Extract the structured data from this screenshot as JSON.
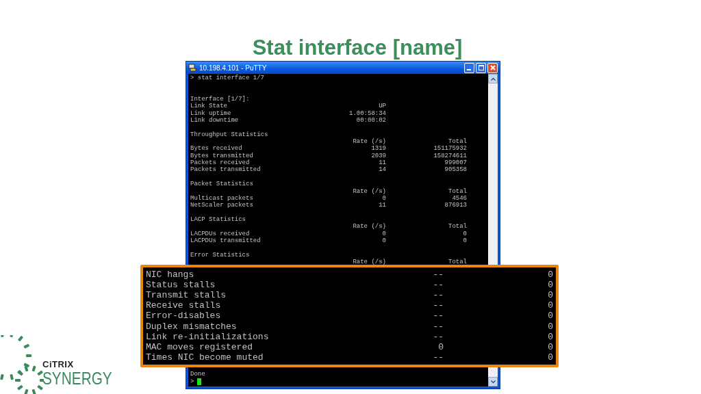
{
  "slide_title": "Stat interface [name]",
  "window": {
    "title": "10.198.4.101 - PuTTY"
  },
  "terminal": {
    "lines": [
      {
        "kind": "command",
        "text": "> stat interface 1/7"
      },
      {
        "kind": "blank"
      },
      {
        "kind": "blank"
      },
      {
        "kind": "row",
        "text": "Interface [1/7]:"
      },
      {
        "kind": "row",
        "text": "Link State",
        "rate": "UP"
      },
      {
        "kind": "row",
        "text": "Link uptime",
        "rate": "1.00:58:34"
      },
      {
        "kind": "row",
        "text": "Link downtime",
        "rate": "00:00:02"
      },
      {
        "kind": "blank"
      },
      {
        "kind": "row",
        "text": "Throughput Statistics"
      },
      {
        "kind": "row",
        "rate": "Rate (/s)",
        "total": "Total"
      },
      {
        "kind": "row",
        "text": "Bytes received",
        "rate": "1319",
        "total": "151175932"
      },
      {
        "kind": "row",
        "text": "Bytes transmitted",
        "rate": "2039",
        "total": "158274611"
      },
      {
        "kind": "row",
        "text": "Packets received",
        "rate": "11",
        "total": "999007"
      },
      {
        "kind": "row",
        "text": "Packets transmitted",
        "rate": "14",
        "total": "905358"
      },
      {
        "kind": "blank"
      },
      {
        "kind": "row",
        "text": "Packet Statistics"
      },
      {
        "kind": "row",
        "rate": "Rate (/s)",
        "total": "Total"
      },
      {
        "kind": "row",
        "text": "Multicast packets",
        "rate": "0",
        "total": "4546"
      },
      {
        "kind": "row",
        "text": "NetScaler packets",
        "rate": "11",
        "total": "876913"
      },
      {
        "kind": "blank"
      },
      {
        "kind": "row",
        "text": "LACP Statistics"
      },
      {
        "kind": "row",
        "rate": "Rate (/s)",
        "total": "Total"
      },
      {
        "kind": "row",
        "text": "LACPDUs received",
        "rate": "0",
        "total": "0"
      },
      {
        "kind": "row",
        "text": "LACPDUs transmitted",
        "rate": "0",
        "total": "0"
      },
      {
        "kind": "blank"
      },
      {
        "kind": "row",
        "text": "Error Statistics"
      },
      {
        "kind": "row",
        "rate": "Rate (/s)",
        "total": "Total"
      }
    ],
    "footer": [
      "Done",
      ">"
    ]
  },
  "callout": {
    "rows": [
      {
        "label": "NIC hangs",
        "rate": "--",
        "total": "0"
      },
      {
        "label": "Status stalls",
        "rate": "--",
        "total": "0"
      },
      {
        "label": "Transmit stalls",
        "rate": "--",
        "total": "0"
      },
      {
        "label": "Receive stalls",
        "rate": "--",
        "total": "0"
      },
      {
        "label": "Error-disables",
        "rate": "--",
        "total": "0"
      },
      {
        "label": "Duplex mismatches",
        "rate": "--",
        "total": "0"
      },
      {
        "label": "Link re-initializations",
        "rate": "--",
        "total": "0"
      },
      {
        "label": "MAC moves registered",
        "rate": "0",
        "total": "0"
      },
      {
        "label": "Times NIC become muted",
        "rate": "--",
        "total": "0"
      }
    ]
  },
  "logo": {
    "brand": "CiTRIX",
    "event": "SYNERGY"
  }
}
